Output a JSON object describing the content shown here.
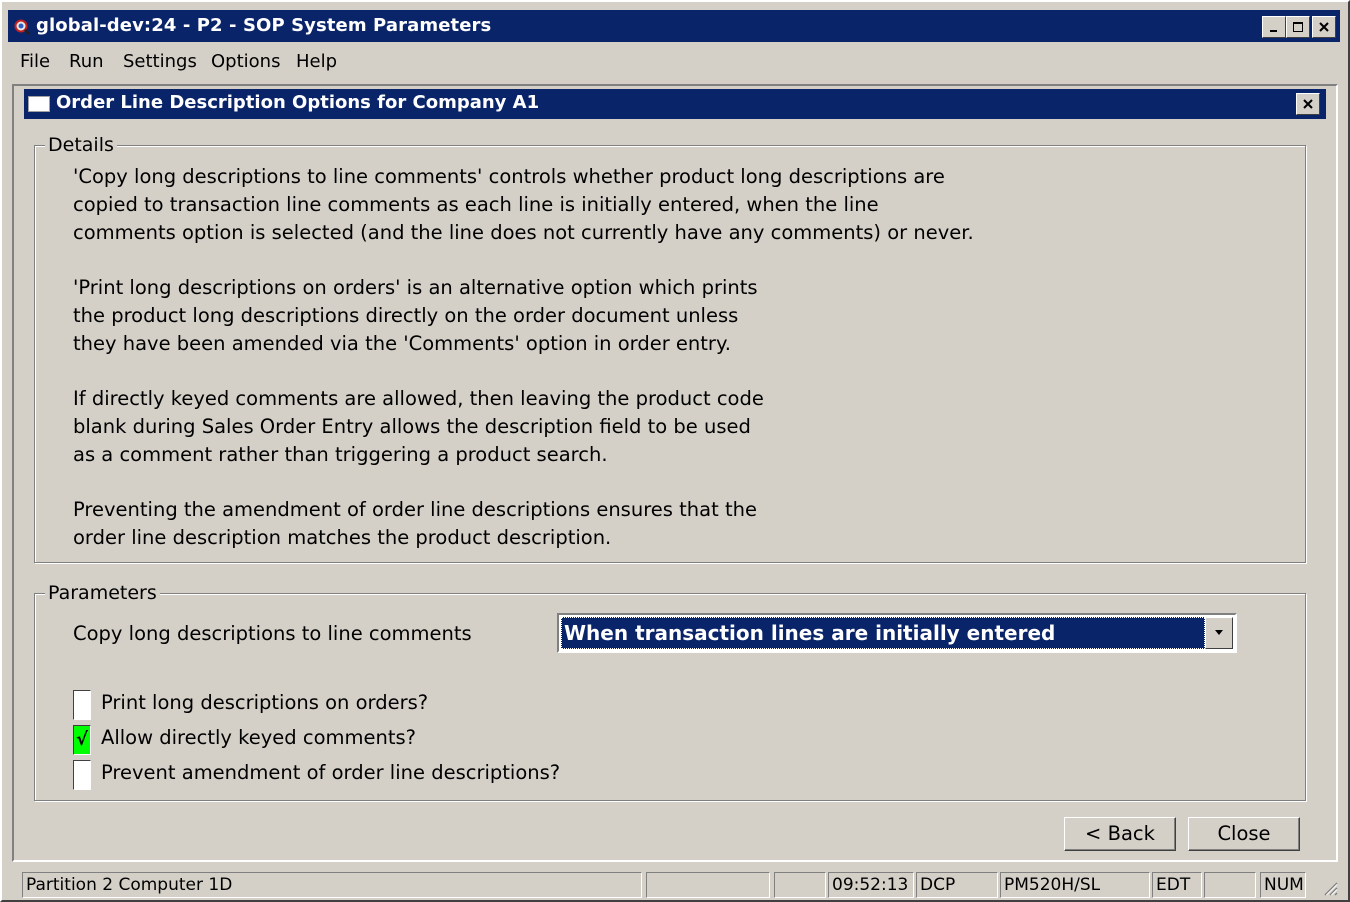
{
  "window": {
    "title": "global-dev:24 - P2 - SOP System Parameters",
    "controls": [
      "minimize",
      "maximize",
      "close"
    ]
  },
  "menubar": {
    "items": [
      "File",
      "Run",
      "Settings",
      "Options",
      "Help"
    ]
  },
  "dialog": {
    "title": "Order Line Description Options for Company A1"
  },
  "details": {
    "legend": "Details",
    "paragraphs": [
      "'Copy long descriptions to line comments' controls whether product long descriptions are\ncopied to transaction line comments as each line is initially entered, when the line\ncomments option is selected (and the line does not currently have any comments) or never.",
      "'Print long descriptions on orders' is an alternative option which prints\nthe product long descriptions directly on the order document unless\nthey have been amended via the 'Comments' option in order entry.",
      "If directly keyed comments are allowed, then leaving the product code\nblank during Sales Order Entry allows the description field to be used\nas a comment rather than triggering a product search.",
      "Preventing the amendment of order line descriptions ensures that the\norder line description matches the product description."
    ]
  },
  "parameters": {
    "legend": "Parameters",
    "copy_label": "Copy long descriptions to line comments",
    "copy_value": "When transaction lines are initially entered",
    "checkboxes": [
      {
        "label": "Print long descriptions on orders?",
        "checked": false,
        "mark": ""
      },
      {
        "label": "Allow directly keyed comments?",
        "checked": true,
        "mark": "√"
      },
      {
        "label": "Prevent amendment of order line descriptions?",
        "checked": false,
        "mark": ""
      }
    ]
  },
  "buttons": {
    "back": "< Back",
    "close": "Close"
  },
  "statusbar": {
    "partition": "Partition 2 Computer 1D",
    "time": "09:52:13",
    "mode": "DCP",
    "program": "PM520H/SL",
    "edit": "EDT",
    "num": "NUM"
  },
  "colors": {
    "titlebar": "#0a246a",
    "face": "#d4d0c8",
    "checked": "#00ff00"
  }
}
